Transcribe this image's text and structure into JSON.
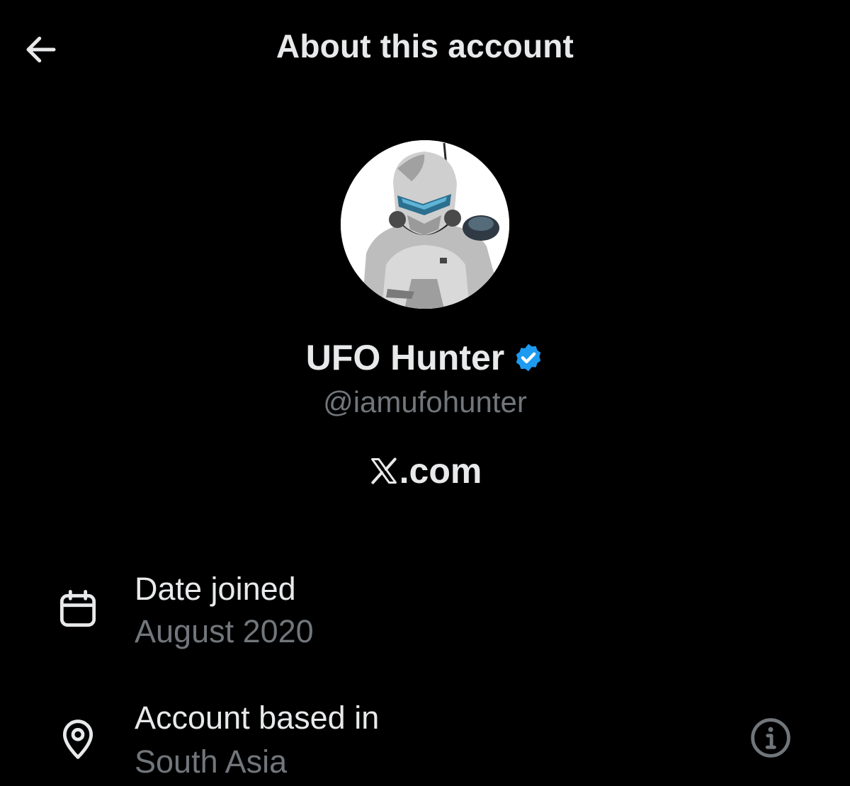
{
  "header": {
    "title": "About this account",
    "back_icon": "arrow-left-icon"
  },
  "profile": {
    "display_name": "UFO Hunter",
    "verified": true,
    "verified_color": "#1d9bf0",
    "handle": "@iamufohunter",
    "avatar_icon": "armored-soldier-avatar",
    "site_logo": "X",
    "site_suffix": ".com"
  },
  "details": [
    {
      "icon": "calendar-icon",
      "title": "Date joined",
      "value": "August 2020"
    },
    {
      "icon": "location-pin-icon",
      "title": "Account based in",
      "value": "South Asia",
      "action_icon": "info-icon"
    }
  ],
  "colors": {
    "background": "#000000",
    "primary_text": "#e7e9ea",
    "secondary_text": "#71767b",
    "accent": "#1d9bf0"
  }
}
